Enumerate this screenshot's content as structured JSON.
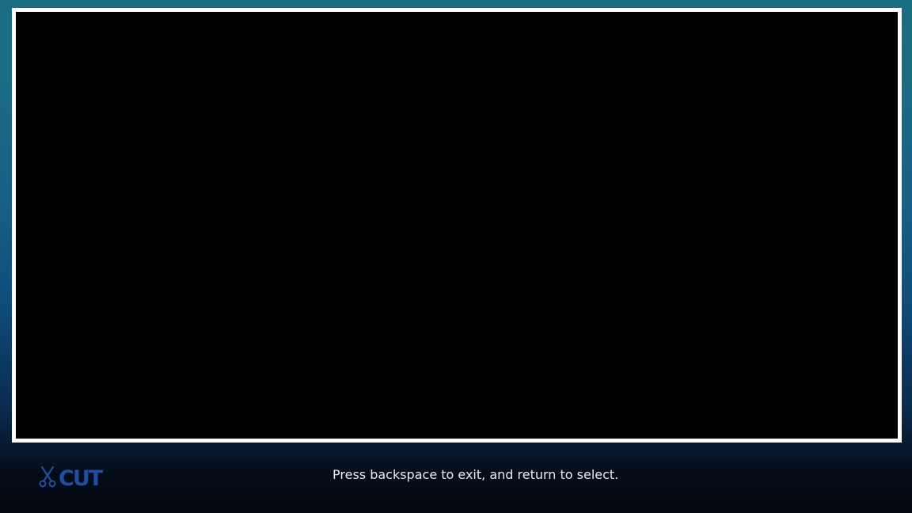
{
  "app": {
    "logo_text": "CUT",
    "logo_icon": "scissors-icon"
  },
  "player": {
    "viewport": "video-viewport"
  },
  "footer": {
    "hint": "Press backspace to exit, and return to select."
  },
  "colors": {
    "frame_border": "#ffffff",
    "viewport_bg": "#000000",
    "logo": "#1f4f9f",
    "hint_text": "#e8ecf2"
  }
}
